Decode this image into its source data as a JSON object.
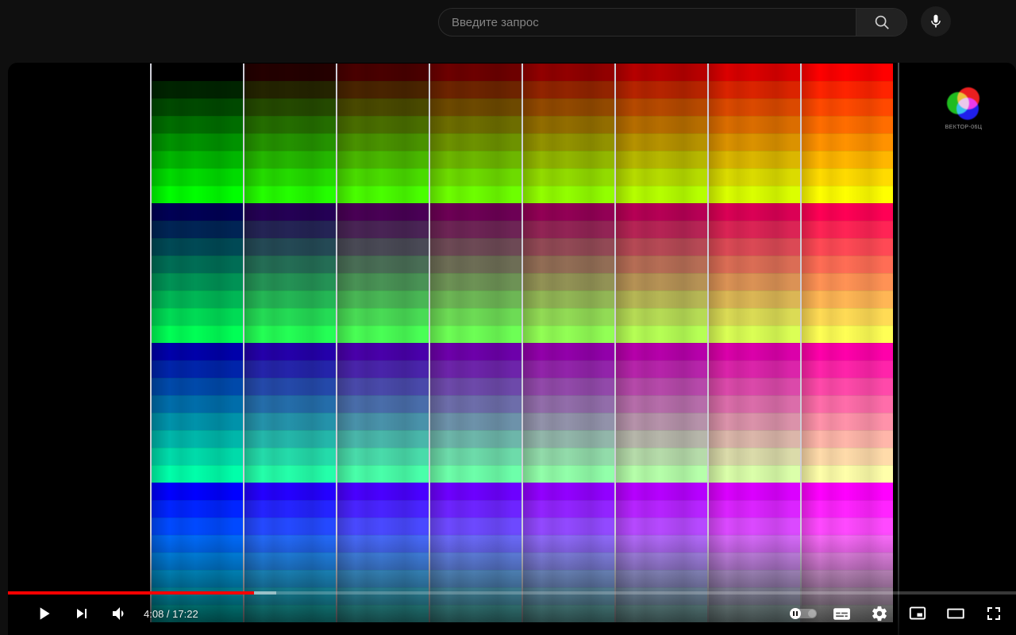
{
  "header": {
    "search": {
      "placeholder": "Введите запрос"
    }
  },
  "player": {
    "time_display": "4:08 / 17:22",
    "current_time": "4:08",
    "duration": "17:22",
    "progress": {
      "played_fraction": 0.244,
      "buffered_fraction": 0.266,
      "played_color": "#ff0000"
    },
    "watermark": {
      "label": "ВЕКТОР-06Ц"
    },
    "control_icon_names": [
      "play-icon",
      "next-icon",
      "volume-icon",
      "autoplay-toggle",
      "subtitles-icon",
      "settings-gear-icon",
      "miniplayer-icon",
      "theater-mode-icon",
      "fullscreen-icon"
    ]
  },
  "video": {
    "palette": {
      "columns": 8,
      "bands": 4,
      "stripes_per_band": 8,
      "red_levels_by_column": [
        0,
        36,
        73,
        109,
        146,
        182,
        219,
        255
      ],
      "green_levels_by_stripe": [
        0,
        36,
        73,
        109,
        146,
        182,
        219,
        255
      ],
      "blue_levels_by_band": [
        0,
        85,
        170,
        255
      ],
      "separator_color": "#ececf6",
      "edge_line_color": "#4a4e50"
    },
    "logo_colors": {
      "red": "#ff2222",
      "green": "#22cc22",
      "blue": "#2222ff"
    }
  }
}
